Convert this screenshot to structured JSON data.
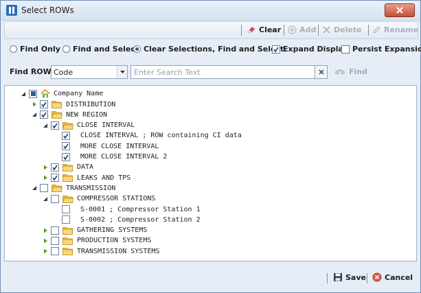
{
  "window": {
    "title": "Select ROWs",
    "app_icon": "app-icon",
    "close_icon": "close-icon",
    "close_color": "#c94c35"
  },
  "toolbar": {
    "clear_label": "Clear",
    "clear_icon": "eraser-icon",
    "add_label": "Add",
    "add_icon": "plus-circle-icon",
    "delete_label": "Delete",
    "delete_icon": "delete-x-icon",
    "rename_label": "Rename",
    "rename_icon": "pencil-icon"
  },
  "options": {
    "radios": [
      {
        "label": "Find Only",
        "selected": false
      },
      {
        "label": "Find and Select",
        "selected": false
      },
      {
        "label": "Clear Selections, Find and Select",
        "selected": true
      }
    ],
    "expand_display": {
      "label": "Expand Display",
      "checked": true
    },
    "persist_expansion": {
      "label": "Persist Expansion",
      "checked": false
    }
  },
  "find_row": {
    "label": "Find ROW",
    "field_value": "Code",
    "search_placeholder": "Enter Search Text",
    "search_value": "",
    "find_label": "Find"
  },
  "tree": {
    "root": {
      "label": "Company Name",
      "state": "partial",
      "icon": "home-icon"
    },
    "nodes": [
      {
        "label": "DISTRIBUTION",
        "level": 1,
        "expander": "collapsed",
        "checked": true,
        "folder": true,
        "folder_open": false
      },
      {
        "label": "NEW REGION",
        "level": 1,
        "expander": "expanded",
        "checked": true,
        "folder": true,
        "folder_open": true
      },
      {
        "label": "CLOSE INTERVAL",
        "level": 2,
        "expander": "expanded",
        "checked": true,
        "folder": true,
        "folder_open": true
      },
      {
        "label": "CLOSE INTERVAL ; ROW containing CI data",
        "level": 3,
        "expander": "none",
        "checked": true,
        "folder": false
      },
      {
        "label": "MORE CLOSE INTERVAL",
        "level": 3,
        "expander": "none",
        "checked": true,
        "folder": false
      },
      {
        "label": "MORE CLOSE INTERVAL 2",
        "level": 3,
        "expander": "none",
        "checked": true,
        "folder": false
      },
      {
        "label": "DATA",
        "level": 2,
        "expander": "collapsed",
        "checked": true,
        "folder": true,
        "folder_open": false
      },
      {
        "label": "LEAKS AND TPS",
        "level": 2,
        "expander": "collapsed",
        "checked": true,
        "folder": true,
        "folder_open": false
      },
      {
        "label": "TRANSMISSION",
        "level": 1,
        "expander": "expanded",
        "checked": false,
        "folder": true,
        "folder_open": true
      },
      {
        "label": "COMPRESSOR STATIONS",
        "level": 2,
        "expander": "expanded",
        "checked": false,
        "folder": true,
        "folder_open": true
      },
      {
        "label": "S-0001 ; Compressor Station 1",
        "level": 3,
        "expander": "none",
        "checked": false,
        "folder": false
      },
      {
        "label": "S-0002 ; Compressor Station 2",
        "level": 3,
        "expander": "none",
        "checked": false,
        "folder": false
      },
      {
        "label": "GATHERING SYSTEMS",
        "level": 2,
        "expander": "collapsed",
        "checked": false,
        "folder": true,
        "folder_open": false
      },
      {
        "label": "PRODUCTION SYSTEMS",
        "level": 2,
        "expander": "collapsed",
        "checked": false,
        "folder": true,
        "folder_open": false
      },
      {
        "label": "TRANSMISSION SYSTEMS",
        "level": 2,
        "expander": "collapsed",
        "checked": false,
        "folder": true,
        "folder_open": false
      }
    ]
  },
  "footer": {
    "save_label": "Save",
    "save_icon": "save-icon",
    "cancel_label": "Cancel",
    "cancel_icon": "cancel-icon"
  },
  "colors": {
    "accent": "#2d5d96",
    "folder": "#f2c65a",
    "disabled_text": "#a9b1bb",
    "window_bg": "#e6edf6"
  }
}
